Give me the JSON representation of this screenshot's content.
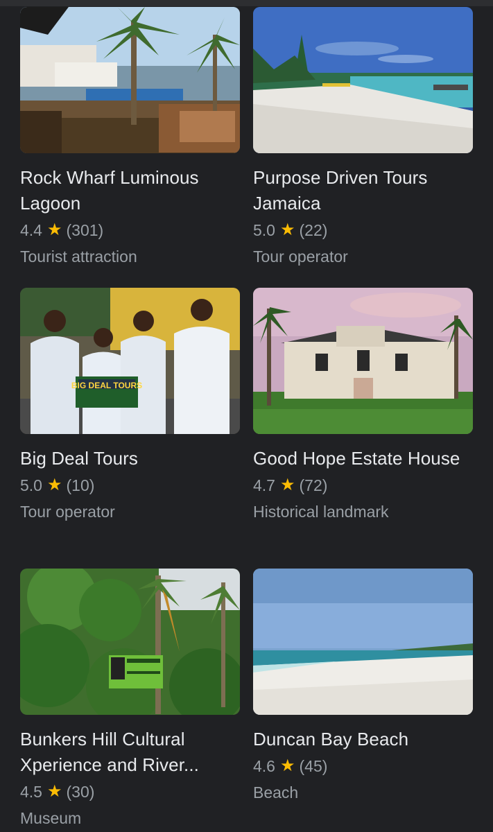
{
  "places": [
    {
      "name": "Rock Wharf Luminous Lagoon",
      "rating": "4.4",
      "reviews": "(301)",
      "category": "Tourist attraction",
      "image_icon": "lagoon-photo"
    },
    {
      "name": "Purpose Driven Tours Jamaica",
      "rating": "5.0",
      "reviews": "(22)",
      "category": "Tour operator",
      "image_icon": "beach-photo"
    },
    {
      "name": "Big Deal Tours",
      "rating": "5.0",
      "reviews": "(10)",
      "category": "Tour operator",
      "image_icon": "tour-group-photo",
      "image_sign_text": "BIG DEAL TOURS"
    },
    {
      "name": "Good Hope Estate House",
      "rating": "4.7",
      "reviews": "(72)",
      "category": "Historical landmark",
      "image_icon": "estate-house-photo"
    },
    {
      "name": "Bunkers Hill Cultural Xperience and River...",
      "rating": "4.5",
      "reviews": "(30)",
      "category": "Museum",
      "image_icon": "jungle-sign-photo"
    },
    {
      "name": "Duncan Bay Beach",
      "rating": "4.6",
      "reviews": "(45)",
      "category": "Beach",
      "image_icon": "beach-photo"
    }
  ],
  "colors": {
    "background": "#202124",
    "title_text": "#e8eaed",
    "secondary_text": "#9aa0a6",
    "star": "#fbbc04"
  },
  "star_glyph": "★"
}
